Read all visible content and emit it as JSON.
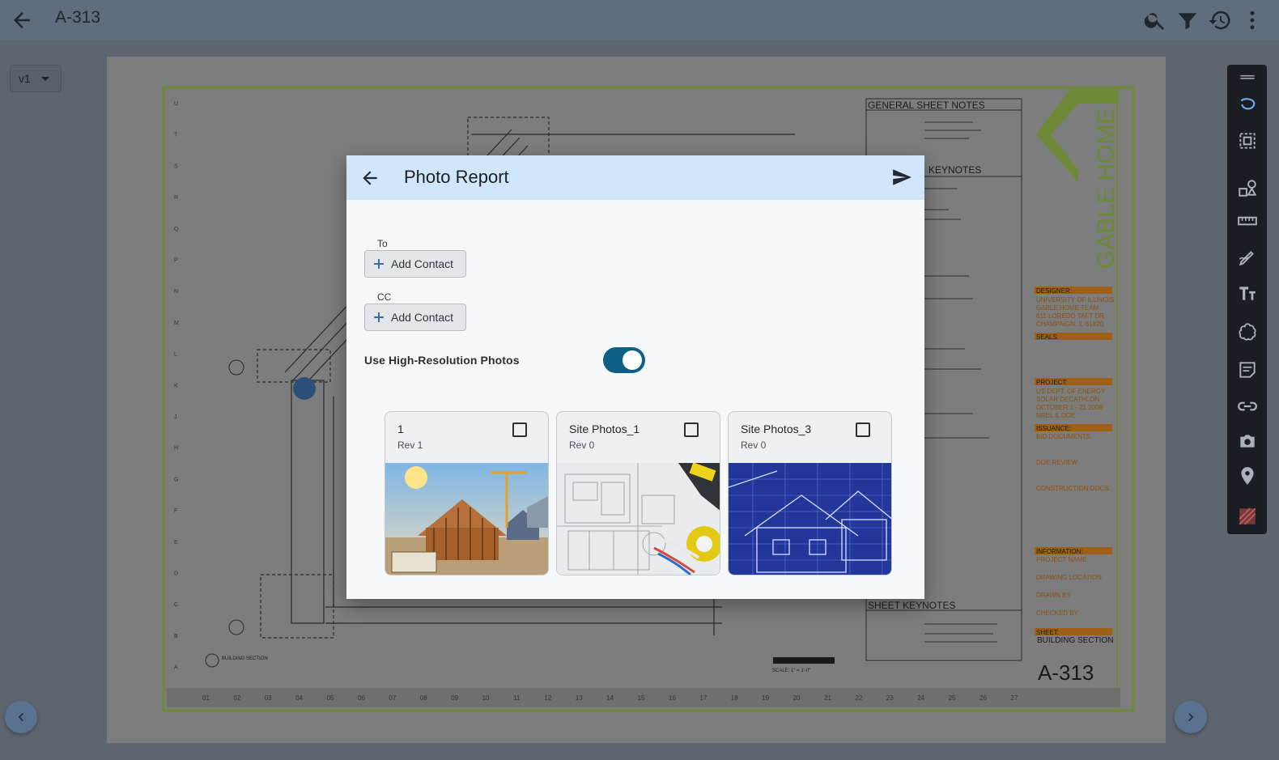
{
  "app": {
    "title": "A-313",
    "version": "v1"
  },
  "drawing": {
    "general_notes_title": "GENERAL SHEET NOTES",
    "keynotes_title": "KEYNOTES",
    "sheet_keynotes_title": "SHEET KEYNOTES",
    "logo_text": "GABLE HOME",
    "designer_label": "DESIGNER:",
    "designer_lines": [
      "UNIVERSITY OF ILLINOIS",
      "GABLE HOME TEAM",
      "611 LOREDO TAFT DR.",
      "CHAMPAIGN, IL 61820"
    ],
    "seals_label": "SEALS:",
    "project_label": "PROJECT:",
    "project_lines": [
      "US DEPT. OF ENERGY",
      "SOLAR DECATHLON",
      "OCTOBER 1 - 21 2009",
      "NREL & DOE"
    ],
    "issuance_label": "ISSUANCE:",
    "issuance_lines": [
      "BID DOCUMENTS",
      "DOE REVIEW",
      "CONSTRUCTION DOCS"
    ],
    "information_label": "INFORMATION:",
    "information_lines": [
      "PROJECT NAME",
      "DRAWING LOCATION",
      "DRAWN BY",
      "CHECKED BY"
    ],
    "sheet_label": "SHEET:",
    "sheet_name": "BUILDING SECTION",
    "sheet_number": "A-313",
    "section_label": "BUILDING SECTION",
    "scale_label": "SCALE: 1\" = 1'-0\"",
    "column_numbers": [
      "01",
      "02",
      "03",
      "04",
      "05",
      "06",
      "07",
      "08",
      "09",
      "10",
      "11",
      "12",
      "13",
      "14",
      "15",
      "16",
      "17",
      "18",
      "19",
      "20",
      "21",
      "22",
      "23",
      "24",
      "25",
      "26",
      "27"
    ],
    "row_letters": [
      "U",
      "T",
      "S",
      "R",
      "Q",
      "P",
      "N",
      "M",
      "L",
      "K",
      "J",
      "H",
      "G",
      "F",
      "E",
      "D",
      "C",
      "B",
      "A"
    ]
  },
  "dialog": {
    "title": "Photo Report",
    "to_label": "To",
    "cc_label": "CC",
    "add_contact_label": "Add Contact",
    "hi_res_label": "Use High-Resolution Photos",
    "hi_res_enabled": true,
    "albums": [
      {
        "title": "1",
        "rev": "Rev 1",
        "checked": false,
        "image": "house-framing-illustration"
      },
      {
        "title": "Site Photos_1",
        "rev": "Rev 0",
        "checked": false,
        "image": "blueprint-with-tools"
      },
      {
        "title": "Site Photos_3",
        "rev": "Rev 0",
        "checked": false,
        "image": "blue-blueprint-house"
      }
    ]
  },
  "icons": {
    "top_actions": [
      "search-icon",
      "filter-icon",
      "history-icon",
      "more-vert-icon"
    ],
    "toolbar": [
      "drag-handle-icon",
      "lasso-icon",
      "select-area-icon",
      "shapes-icon",
      "ruler-icon",
      "pen-icon",
      "text-icon",
      "cloud-icon",
      "note-icon",
      "link-icon",
      "camera-icon",
      "location-pin-icon",
      "hatch-icon"
    ]
  },
  "colors": {
    "dialog_header": "#cfe6fb",
    "toggle_on": "#0d5f86",
    "drawing_border": "#8db33c",
    "titleblock_orange": "#c8781a"
  }
}
